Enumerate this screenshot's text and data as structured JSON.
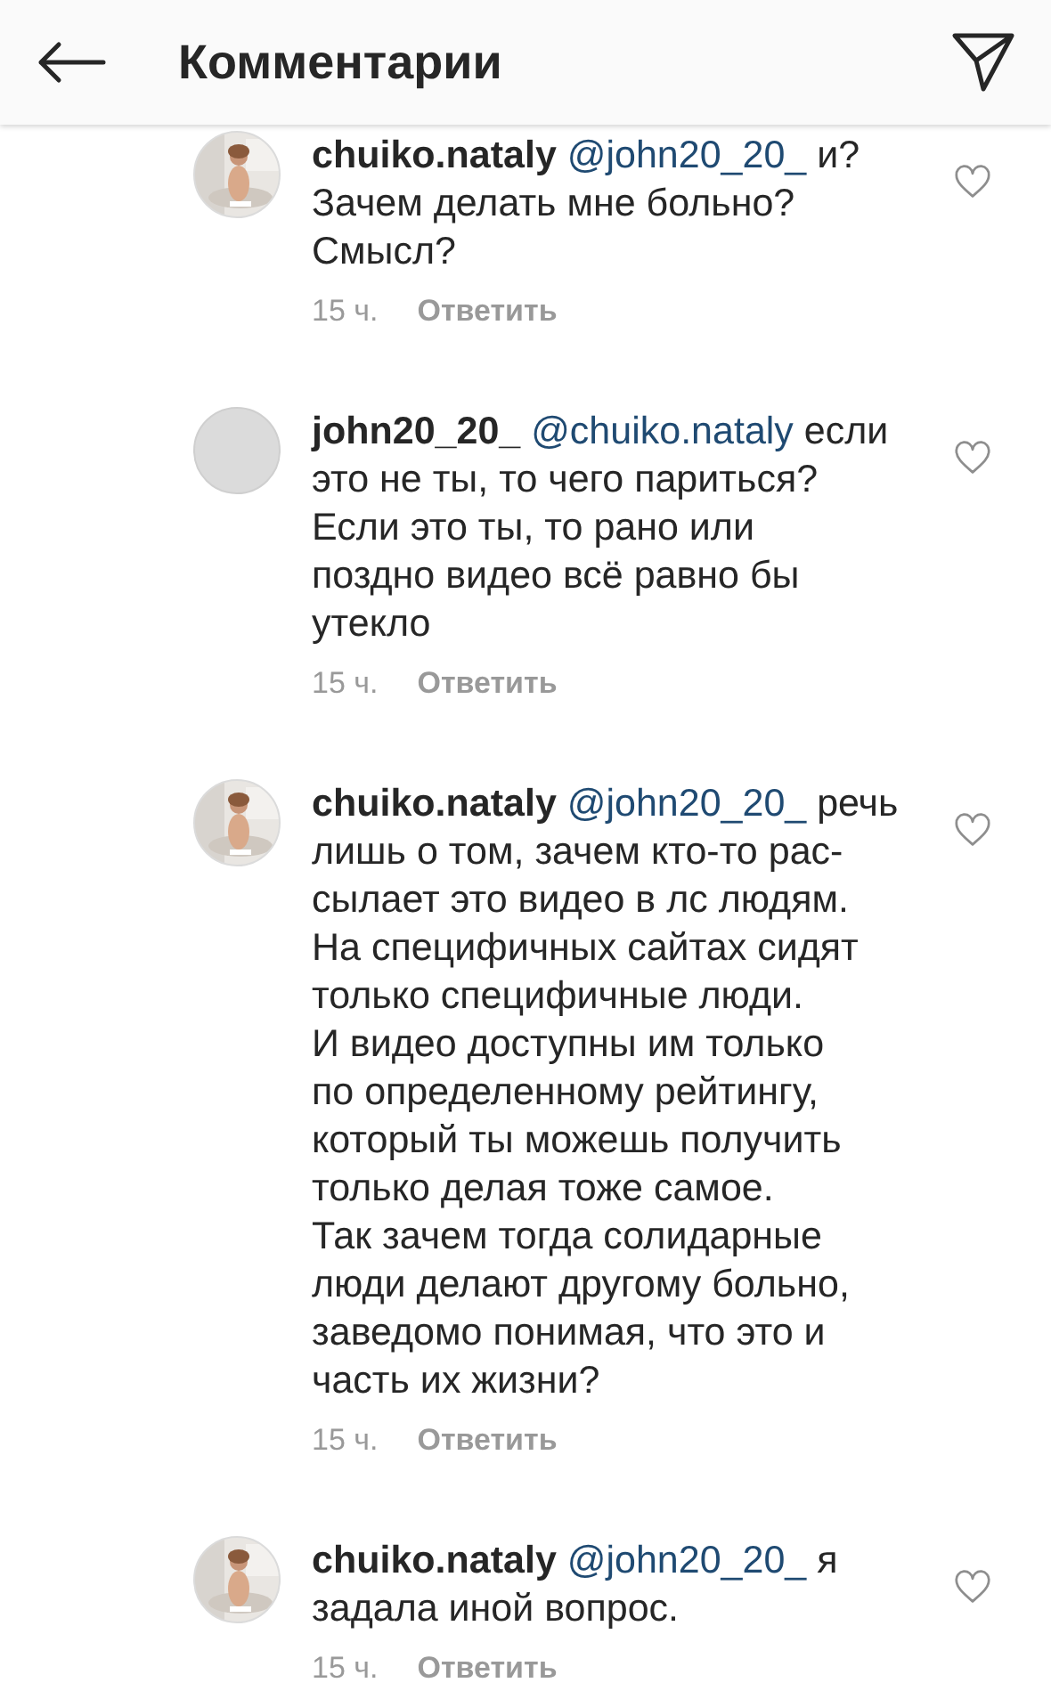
{
  "header": {
    "title": "Комментарии"
  },
  "comments": [
    {
      "username": "chuiko.nataly",
      "mention": "@john20_20_",
      "text": "и?\nЗачем делать мне больно?\nСмысл?",
      "time": "15 ч.",
      "reply": "Ответить",
      "liked": false
    },
    {
      "avatar": {
        "kind": "default"
      },
      "username": "john20_20_",
      "mention": "@chuiko.nataly",
      "text": "если\nэто не ты, то чего париться?\nЕсли это ты, то рано или\nпоздно видео всё равно бы\nутекло",
      "time": "15 ч.",
      "reply": "Ответить",
      "liked": false
    },
    {
      "username": "chuiko.nataly",
      "mention": "@john20_20_",
      "text": "речь\nлишь о том, зачем кто-то рас-\nсылает это видео в лс людям.\nНа специфичных сайтах сидят\nтолько специфичные люди.\nИ видео доступны им только\nпо определенному рейтингу,\nкоторый ты можешь получить\nтолько делая тоже самое.\nТак зачем тогда солидарные\nлюди делают другому больно,\nзаведомо понимая, что это и\nчасть их жизни?",
      "time": "15 ч.",
      "reply": "Ответить",
      "liked": false
    },
    {
      "username": "chuiko.nataly",
      "mention": "@john20_20_",
      "text": "я\nзадала иной вопрос.",
      "time": "15 ч.",
      "reply": "Ответить",
      "liked": false
    }
  ]
}
